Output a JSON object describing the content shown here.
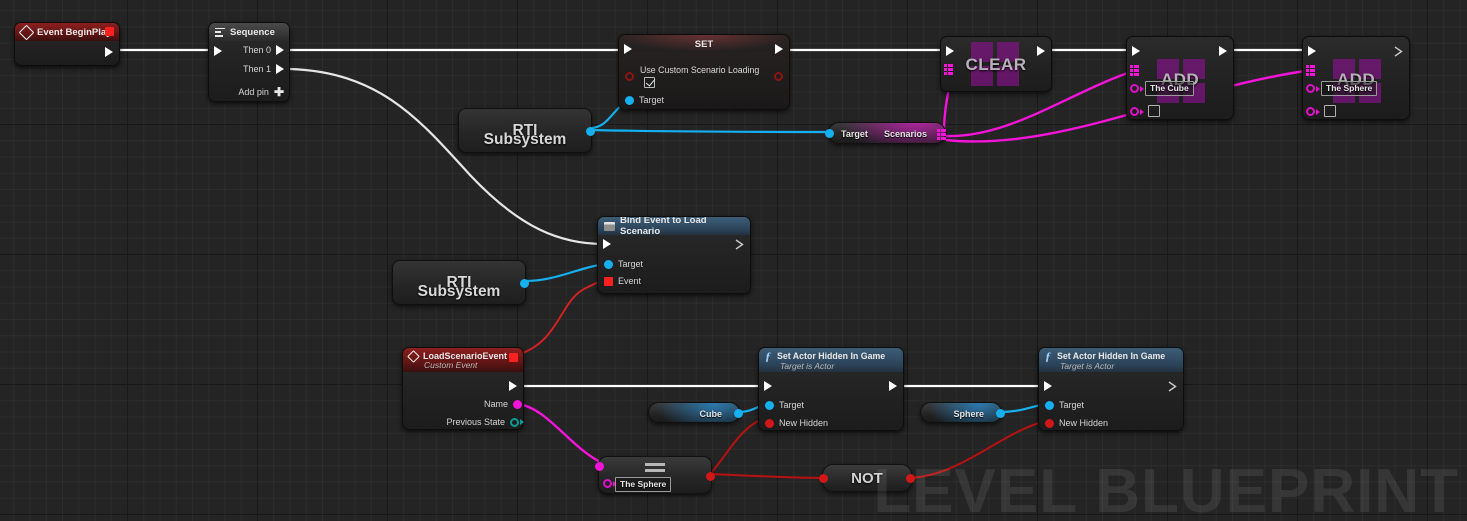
{
  "canvas": {
    "watermark": "LEVEL BLUEPRINT",
    "background_color": "#242424",
    "grid_minor_color": "#2f2f2f",
    "grid_major_color": "#141414"
  },
  "nodes": {
    "event_begin_play": {
      "title": "Event BeginPlay",
      "icon": "event-diamond-icon",
      "header_color": "#5d1414",
      "exec_out": ""
    },
    "sequence": {
      "title": "Sequence",
      "icon": "sequence-icon",
      "header_color": "#343434",
      "pins": [
        {
          "label": "Then 0"
        },
        {
          "label": "Then 1"
        },
        {
          "label": "Add pin"
        }
      ]
    },
    "set_node": {
      "title": "SET",
      "property_label": "Use Custom Scenario Loading",
      "checkbox_checked": true,
      "target_label": "Target"
    },
    "rti_subsystem_top": {
      "line1": "RTI",
      "line2": "Subsystem"
    },
    "rti_subsystem_bottom": {
      "line1": "RTI",
      "line2": "Subsystem"
    },
    "scenarios_var": {
      "target_label": "Target",
      "name": "Scenarios"
    },
    "clear_node": {
      "label": "CLEAR"
    },
    "add_cube_node": {
      "label": "ADD",
      "value": "The Cube",
      "checkbox_checked": false
    },
    "add_sphere_node": {
      "label": "ADD",
      "value": "The Sphere",
      "checkbox_checked": false
    },
    "bind_event": {
      "title": "Bind Event to Load Scenario",
      "icon": "bind-event-icon",
      "pins": [
        {
          "label": "Target",
          "type": "object"
        },
        {
          "label": "Event",
          "type": "delegate"
        }
      ]
    },
    "load_scenario_event": {
      "title": "LoadScenarioEvent",
      "subtitle": "Custom Event",
      "icon": "event-diamond-icon",
      "pins": [
        {
          "label": "Name"
        },
        {
          "label": "Previous State"
        }
      ]
    },
    "set_actor_hidden_1": {
      "title": "Set Actor Hidden In Game",
      "subtitle": "Target is Actor",
      "icon": "function-icon",
      "pins": [
        {
          "label": "Target"
        },
        {
          "label": "New Hidden"
        }
      ]
    },
    "set_actor_hidden_2": {
      "title": "Set Actor Hidden In Game",
      "subtitle": "Target is Actor",
      "icon": "function-icon",
      "pins": [
        {
          "label": "Target"
        },
        {
          "label": "New Hidden"
        }
      ]
    },
    "cube_var": {
      "name": "Cube"
    },
    "sphere_var": {
      "name": "Sphere"
    },
    "equal_node": {
      "operator": "==",
      "value": "The Sphere"
    },
    "not_node": {
      "label": "NOT"
    }
  },
  "wire_colors": {
    "exec": "#ffffff",
    "object": "#15b0ef",
    "array_struct": "#f413d9",
    "boolean": "#b81111",
    "delegate": "#d01818"
  }
}
